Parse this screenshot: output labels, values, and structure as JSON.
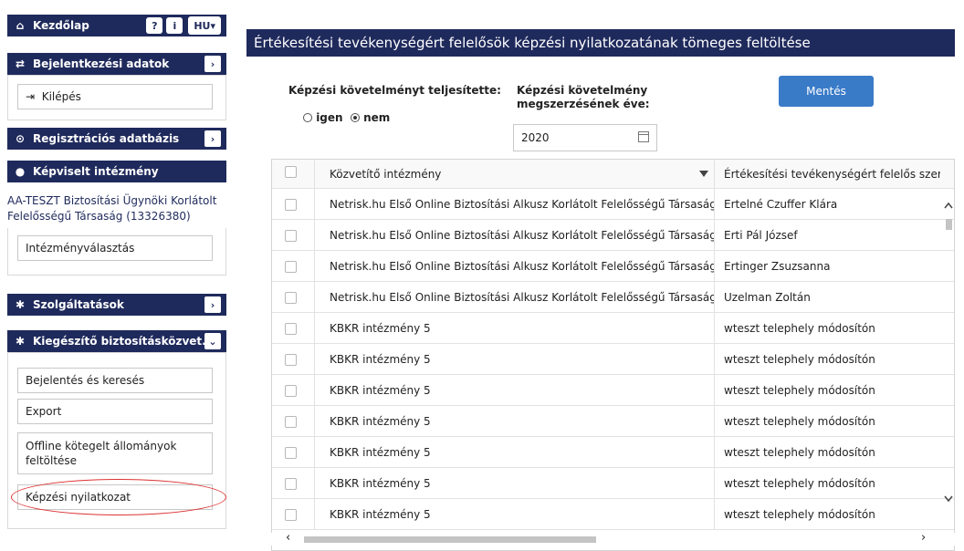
{
  "sidebar": {
    "home_label": "Kezdőlap",
    "help_icon_label": "?",
    "info_icon_label": "i",
    "lang_label": "HU▾",
    "login_data_label": "Bejelentkezési adatok",
    "logout_label": "Kilépés",
    "registry_label": "Regisztrációs adatbázis",
    "represented_label": "Képviselt intézmény",
    "institution_name": "AA-TESZT Biztosítási Ügynöki Korlátolt Felelősségű Társaság (13326380)",
    "select_institution_label": "Intézményválasztás",
    "services_label": "Szolgáltatások",
    "supplementary_label": "Kiegészítő biztosításközvet...",
    "menu": [
      {
        "label": "Bejelentés és keresés"
      },
      {
        "label": "Export"
      },
      {
        "label": "Offline kötegelt állományok feltöltése"
      },
      {
        "label": "Képzési nyilatkozat"
      }
    ]
  },
  "main": {
    "title": "Értékesítési tevékenységért felelősök képzési nyilatkozatának tömeges feltöltése",
    "completed_label": "Képzési követelményt teljesítette:",
    "radio_yes": "igen",
    "radio_no": "nem",
    "selected_radio": "nem",
    "year_label": "Képzési követelmény megszerzésének éve:",
    "year_value": "2020",
    "save_label": "Mentés",
    "table": {
      "columns": [
        "Közvetítő intézmény",
        "Értékesítési tevékenységért felelős személy"
      ],
      "rows": [
        [
          "Netrisk.hu Első Online Biztosítási Alkusz Korlátolt Felelősségű Társaság",
          "Ertelné Czuffer Klára"
        ],
        [
          "Netrisk.hu Első Online Biztosítási Alkusz Korlátolt Felelősségű Társaság",
          "Erti Pál József"
        ],
        [
          "Netrisk.hu Első Online Biztosítási Alkusz Korlátolt Felelősségű Társaság",
          "Ertinger Zsuzsanna"
        ],
        [
          "Netrisk.hu Első Online Biztosítási Alkusz Korlátolt Felelősségű Társaság",
          "Uzelman Zoltán"
        ],
        [
          "KBKR intézmény 5",
          "wteszt telephely módosítón"
        ],
        [
          "KBKR intézmény 5",
          "wteszt telephely módosítón"
        ],
        [
          "KBKR intézmény 5",
          "wteszt telephely módosítón"
        ],
        [
          "KBKR intézmény 5",
          "wteszt telephely módosítón"
        ],
        [
          "KBKR intézmény 5",
          "wteszt telephely módosítón"
        ],
        [
          "KBKR intézmény 5",
          "wteszt telephely módosítón"
        ],
        [
          "KBKR intézmény 5",
          "wteszt telephely módosítón"
        ]
      ]
    }
  },
  "colors": {
    "navy": "#1f2a5c",
    "save": "#3a7bc8",
    "highlight": "#dd3333"
  }
}
